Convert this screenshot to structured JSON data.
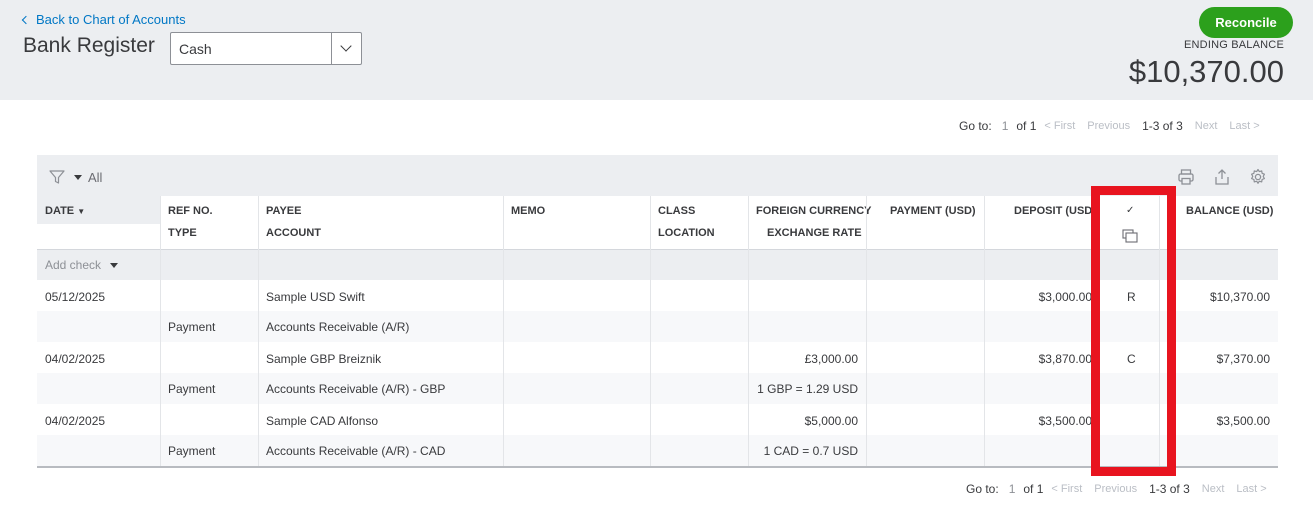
{
  "header": {
    "back_link": "Back to Chart of Accounts",
    "title": "Bank Register",
    "account_select": "Cash",
    "reconcile_label": "Reconcile",
    "ending_balance_label": "ENDING BALANCE",
    "ending_balance_value": "$10,370.00"
  },
  "pager": {
    "goto_label": "Go to:",
    "current_page": "1",
    "of_pages": "of 1",
    "first": "< First",
    "previous": "Previous",
    "range": "1-3 of 3",
    "next": "Next",
    "last": "Last >"
  },
  "filter": {
    "label": "All"
  },
  "columns": {
    "date": "DATE",
    "ref_no": "REF NO.",
    "type": "TYPE",
    "payee": "PAYEE",
    "account": "ACCOUNT",
    "memo": "MEMO",
    "class": "CLASS",
    "location": "LOCATION",
    "foreign_currency": "FOREIGN CURRENCY",
    "exchange_rate": "EXCHANGE RATE",
    "payment": "PAYMENT (USD)",
    "deposit": "DEPOSIT (USD)",
    "check": "✓",
    "balance": "BALANCE (USD)"
  },
  "add_check": "Add check",
  "transactions": [
    {
      "date": "05/12/2025",
      "payee": "Sample USD Swift",
      "type": "Payment",
      "account": "Accounts Receivable (A/R)",
      "foreign_amount": "",
      "exchange_rate": "",
      "deposit": "$3,000.00",
      "status": "R",
      "balance": "$10,370.00"
    },
    {
      "date": "04/02/2025",
      "payee": "Sample GBP Breiznik",
      "type": "Payment",
      "account": "Accounts Receivable (A/R) - GBP",
      "foreign_amount": "£3,000.00",
      "exchange_rate": "1 GBP = 1.29 USD",
      "deposit": "$3,870.00",
      "status": "C",
      "balance": "$7,370.00"
    },
    {
      "date": "04/02/2025",
      "payee": "Sample CAD Alfonso",
      "type": "Payment",
      "account": "Accounts Receivable (A/R) - CAD",
      "foreign_amount": "$5,000.00",
      "exchange_rate": "1 CAD = 0.7 USD",
      "deposit": "$3,500.00",
      "status": "",
      "balance": "$3,500.00"
    }
  ],
  "colors": {
    "accent_blue": "#0077c5",
    "reconcile_green": "#2ca01c",
    "highlight_red": "#e8141f",
    "header_bg": "#eceef1"
  },
  "icons": [
    "chevron-left-icon",
    "chevron-down-icon",
    "funnel-icon",
    "caret-down-icon",
    "print-icon",
    "export-icon",
    "gear-icon",
    "copy-icon"
  ]
}
